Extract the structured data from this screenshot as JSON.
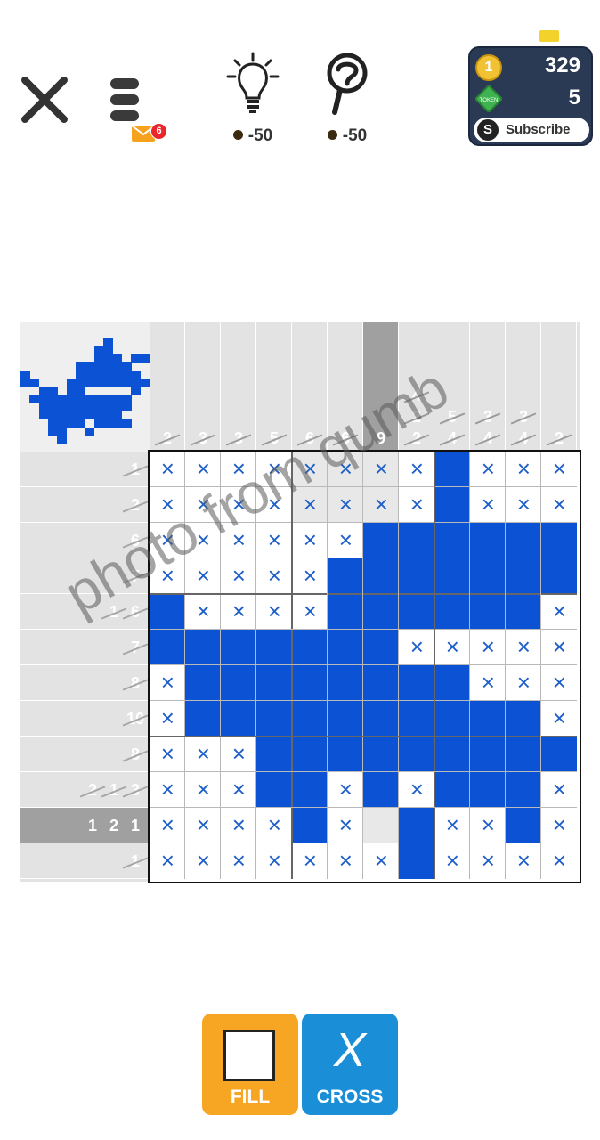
{
  "toolbar": {
    "close_icon": "close-icon",
    "menu_icon": "menu-icon",
    "mail_badge": "6",
    "hint": {
      "icon": "lightbulb-icon",
      "cost": "-50"
    },
    "reveal": {
      "icon": "magnifier-question-icon",
      "cost": "-50"
    }
  },
  "wallet": {
    "coin_icon_text": "1",
    "coins": "329",
    "tokens": "5",
    "token_icon_text": "TOKEN",
    "subscribe_icon_text": "S",
    "subscribe_label": "Subscribe"
  },
  "puzzle": {
    "size": 12,
    "colors": {
      "filled": "#0b52d4",
      "cross": "#1f5fc8",
      "active_clue": "#a0a0a0"
    },
    "col_clues": [
      {
        "nums": [
          "2"
        ],
        "done": [
          true
        ],
        "active": false
      },
      {
        "nums": [
          "3"
        ],
        "done": [
          true
        ],
        "active": false
      },
      {
        "nums": [
          "3"
        ],
        "done": [
          true
        ],
        "active": false
      },
      {
        "nums": [
          "5"
        ],
        "done": [
          true
        ],
        "active": false
      },
      {
        "nums": [
          "6"
        ],
        "done": [
          true
        ],
        "active": false
      },
      {
        "nums": [
          "6"
        ],
        "done": [
          true
        ],
        "active": false
      },
      {
        "nums": [
          "9"
        ],
        "done": [
          false
        ],
        "active": true
      },
      {
        "nums": [
          "4",
          "2",
          "2"
        ],
        "done": [
          true,
          true,
          true
        ],
        "active": false
      },
      {
        "nums": [
          "5",
          "4"
        ],
        "done": [
          true,
          true
        ],
        "active": false
      },
      {
        "nums": [
          "3",
          "4"
        ],
        "done": [
          true,
          true
        ],
        "active": false
      },
      {
        "nums": [
          "3",
          "4"
        ],
        "done": [
          true,
          true
        ],
        "active": false
      },
      {
        "nums": [
          "2"
        ],
        "done": [
          true
        ],
        "active": false
      }
    ],
    "row_clues": [
      {
        "nums": [
          "1"
        ],
        "done": [
          true
        ],
        "active": false
      },
      {
        "nums": [
          "2"
        ],
        "done": [
          true
        ],
        "active": false
      },
      {
        "nums": [
          "6"
        ],
        "done": [
          true
        ],
        "active": false
      },
      {
        "nums": [
          "7"
        ],
        "done": [
          true
        ],
        "active": false
      },
      {
        "nums": [
          "1",
          "6"
        ],
        "done": [
          true,
          true
        ],
        "active": false
      },
      {
        "nums": [
          "7"
        ],
        "done": [
          true
        ],
        "active": false
      },
      {
        "nums": [
          "8"
        ],
        "done": [
          true
        ],
        "active": false
      },
      {
        "nums": [
          "10"
        ],
        "done": [
          true
        ],
        "active": false
      },
      {
        "nums": [
          "8"
        ],
        "done": [
          true
        ],
        "active": false
      },
      {
        "nums": [
          "2",
          "1",
          "3"
        ],
        "done": [
          true,
          true,
          true
        ],
        "active": false
      },
      {
        "nums": [
          "1",
          "2",
          "1"
        ],
        "done": [
          false,
          false,
          false
        ],
        "active": true
      },
      {
        "nums": [
          "1"
        ],
        "done": [
          true
        ],
        "active": false
      }
    ],
    "grid": [
      "XXXXXXXX#XXX",
      "XXXXXXXX#XXX",
      "XXXXXX######",
      "XXXXX#######",
      "#XXXX######X",
      "#######XXXXX",
      "X########XXX",
      "X##########X",
      "XXX#########X",
      "XXX##X#X###X",
      "XXXX#X.#XX#X",
      "XXXXXXX#XXXX"
    ],
    "shaded_cols": [
      4,
      5,
      6
    ],
    "preview": [
      "..............",
      "..............",
      ".........#....",
      "........##....",
      "........###.##",
      "......######..",
      "#.....#######.",
      "##...#########",
      "..##.##.....#.",
      ".###########..",
      "..##########..",
      "..#########...",
      "...####.####..",
      "...##..#......",
      "....#.........",
      ".............."
    ]
  },
  "tools": {
    "fill_label": "FILL",
    "cross_label": "CROSS",
    "cross_glyph": "X"
  },
  "watermark": "photo from qumb"
}
